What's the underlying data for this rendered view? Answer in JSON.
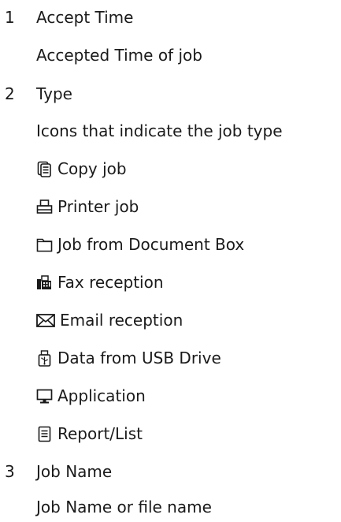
{
  "items": [
    {
      "number": "1",
      "heading": "Accept Time",
      "description": "Accepted Time of job"
    },
    {
      "number": "2",
      "heading": "Type",
      "description": "Icons that indicate the job type",
      "types": [
        {
          "icon": "copy-job-icon",
          "label": "Copy job"
        },
        {
          "icon": "printer-icon",
          "label": "Printer job"
        },
        {
          "icon": "folder-icon",
          "label": "Job from Document Box"
        },
        {
          "icon": "fax-icon",
          "label": "Fax reception"
        },
        {
          "icon": "envelope-icon",
          "label": "Email reception"
        },
        {
          "icon": "usb-drive-icon",
          "label": "Data from USB Drive"
        },
        {
          "icon": "monitor-icon",
          "label": "Application"
        },
        {
          "icon": "report-icon",
          "label": "Report/List"
        }
      ]
    },
    {
      "number": "3",
      "heading": "Job Name",
      "description": "Job Name or file name"
    }
  ]
}
